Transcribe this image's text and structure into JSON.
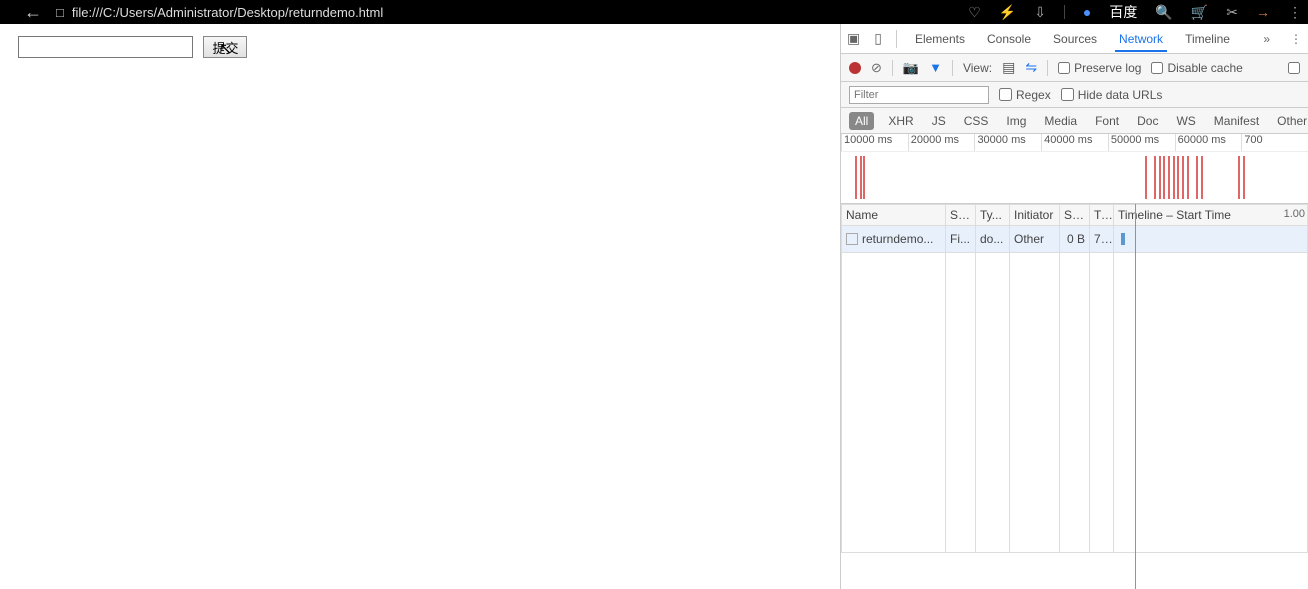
{
  "browser": {
    "url": "file:///C:/Users/Administrator/Desktop/returndemo.html",
    "baidu_label": "百度"
  },
  "page": {
    "input_value": "",
    "submit_label": "提交"
  },
  "devtools": {
    "tabs": {
      "elements": "Elements",
      "console": "Console",
      "sources": "Sources",
      "network": "Network",
      "timeline": "Timeline"
    },
    "active_tab": "network",
    "toolbar": {
      "view_label": "View:",
      "preserve_log": "Preserve log",
      "disable_cache": "Disable cache"
    },
    "filter": {
      "placeholder": "Filter",
      "regex": "Regex",
      "hide_data_urls": "Hide data URLs"
    },
    "types": {
      "all": "All",
      "xhr": "XHR",
      "js": "JS",
      "css": "CSS",
      "img": "Img",
      "media": "Media",
      "font": "Font",
      "doc": "Doc",
      "ws": "WS",
      "manifest": "Manifest",
      "other": "Other"
    },
    "overview_ticks": [
      "10000 ms",
      "20000 ms",
      "30000 ms",
      "40000 ms",
      "50000 ms",
      "60000 ms",
      "700"
    ],
    "overview_bar_positions_pct": [
      3,
      4,
      4.8,
      65,
      67,
      68,
      69,
      70,
      71,
      72,
      73,
      74,
      76,
      77,
      85,
      86
    ],
    "grid": {
      "headers": {
        "name": "Name",
        "status": "St...",
        "type": "Ty...",
        "initiator": "Initiator",
        "size": "Size",
        "time": "Ti...",
        "timeline": "Timeline – Start Time"
      },
      "timeline_right": "1.00",
      "rows": [
        {
          "name": "returndemo...",
          "status": "Fi...",
          "type": "do...",
          "initiator": "Other",
          "size": "0 B",
          "time": "7..."
        }
      ]
    }
  }
}
